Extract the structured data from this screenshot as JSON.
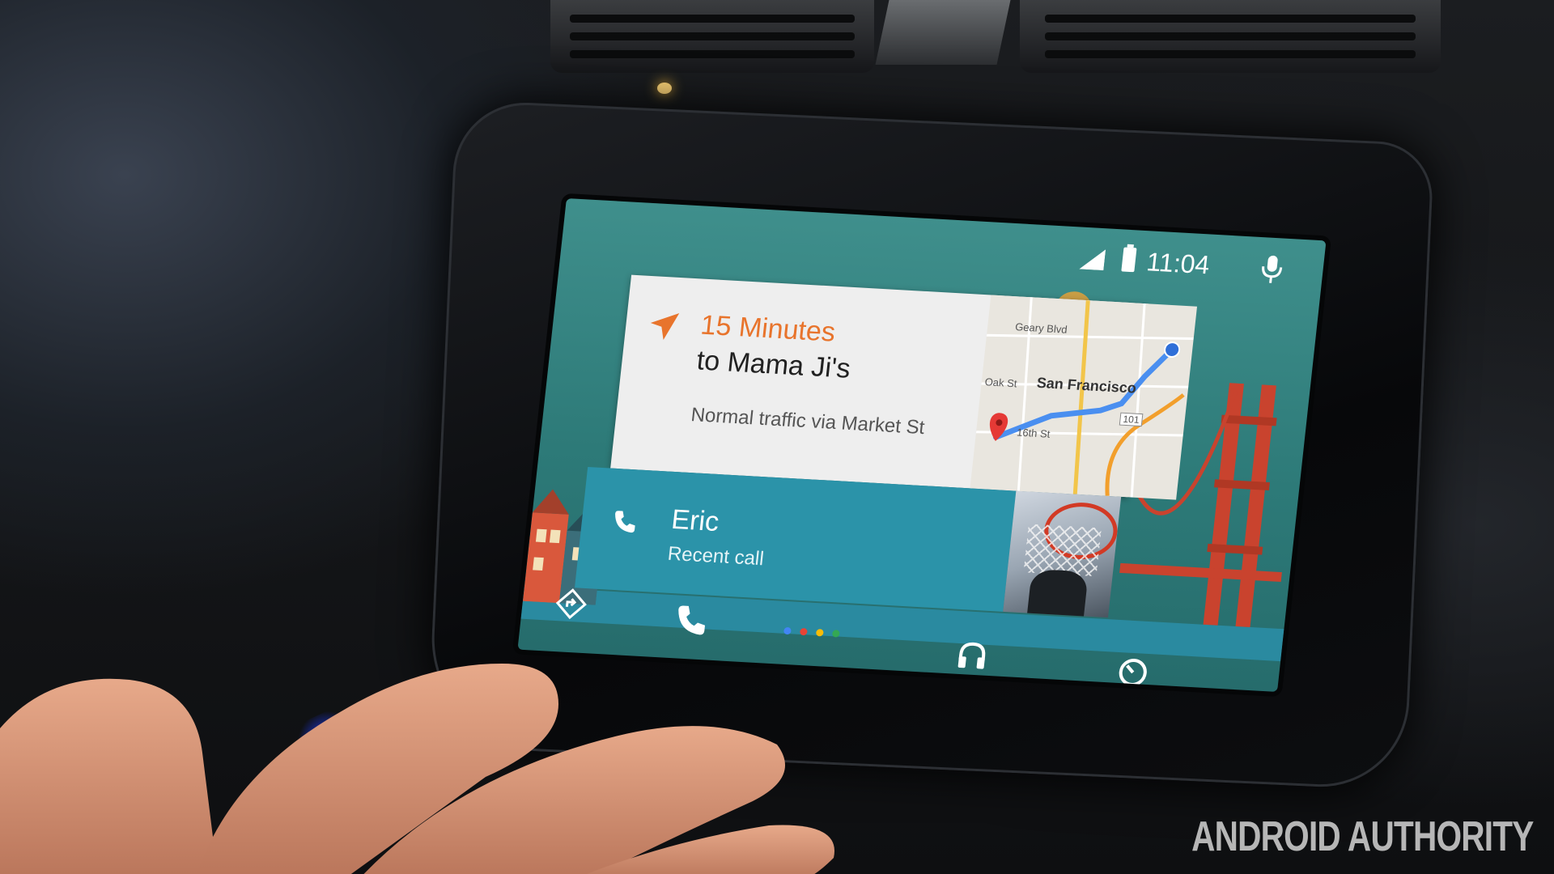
{
  "status_bar": {
    "time": "11:04",
    "signal_icon": "signal-icon",
    "battery_icon": "battery-icon",
    "mic_icon": "mic-icon"
  },
  "navigation_card": {
    "eta": "15 Minutes",
    "destination": "to Mama Ji's",
    "traffic": "Normal traffic via Market St",
    "accent_color": "#e8742c",
    "map": {
      "city_label": "San Francisco",
      "street_labels": [
        "Geary Blvd",
        "Oak St",
        "16th St"
      ],
      "highway_shield": "101",
      "route_color": "#4a8ff0"
    }
  },
  "call_card": {
    "caller": "Eric",
    "subtitle": "Recent call",
    "color": "#2b93a9",
    "icon": "phone-icon"
  },
  "bottom_nav": {
    "items": [
      "navigation-icon",
      "phone-icon",
      "home-dots",
      "headphones-icon",
      "exit-icon"
    ],
    "dot_colors": [
      "#4285f4",
      "#ea4335",
      "#fbbc05",
      "#34a853"
    ]
  },
  "watermark": "ANDROID AUTHORITY"
}
